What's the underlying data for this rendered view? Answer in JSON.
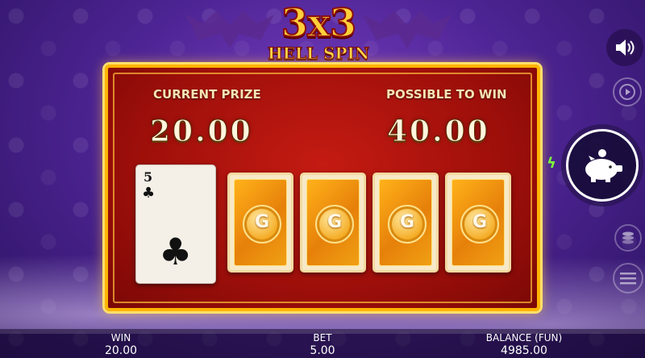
{
  "logo": {
    "title": "3x3",
    "subtitle": "HELL SPIN"
  },
  "panel": {
    "current_prize_label": "CURRENT PRIZE",
    "current_prize_value": "20.00",
    "possible_label": "POSSIBLE TO WIN",
    "possible_value": "40.00"
  },
  "cards": {
    "revealed": {
      "rank": "5",
      "suit": "♣"
    },
    "hidden": [
      {
        "logo": "G"
      },
      {
        "logo": "G"
      },
      {
        "logo": "G"
      },
      {
        "logo": "G"
      }
    ]
  },
  "controls": {
    "sound_icon": "speaker-icon",
    "replay_icon": "play-circle-icon",
    "piggy_icon": "piggy-bank-icon",
    "bolt_icon": "lightning-icon",
    "coins_icon": "coin-stack-icon",
    "menu_icon": "hamburger-menu-icon"
  },
  "bottom_bar": {
    "win_label": "WIN",
    "win_value": "20.00",
    "bet_label": "BET",
    "bet_value": "5.00",
    "balance_label": "BALANCE (FUN)",
    "balance_value": "4985.00"
  },
  "colors": {
    "panel_red": "#b0140d",
    "gold": "#ffb400",
    "purple_bg": "#5a2aa0"
  }
}
